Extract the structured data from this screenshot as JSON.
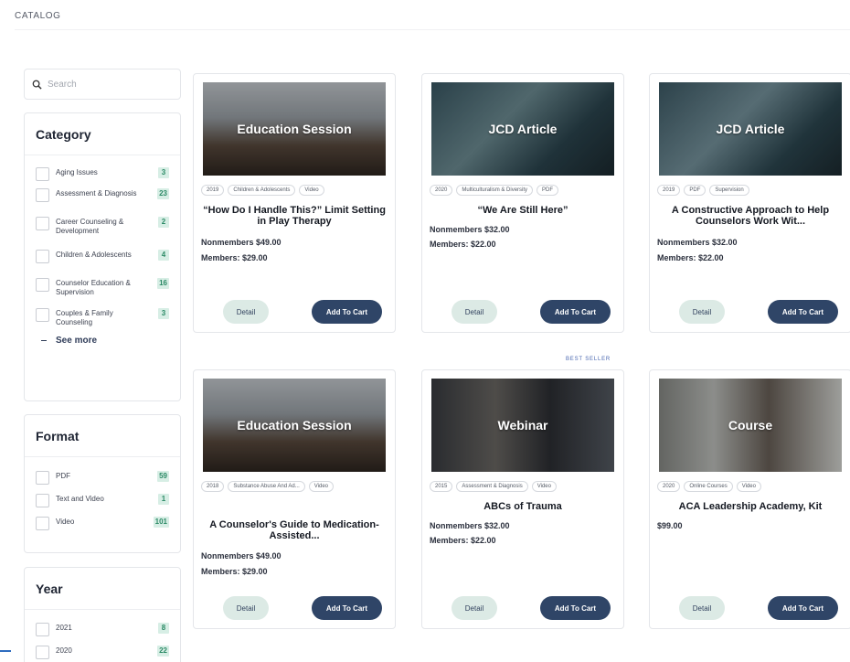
{
  "page": {
    "title": "CATALOG"
  },
  "search": {
    "placeholder": "Search"
  },
  "filters": {
    "category": {
      "title": "Category",
      "items": [
        {
          "label": "Aging Issues",
          "count": "3"
        },
        {
          "label": "Assessment & Diagnosis",
          "count": "23"
        },
        {
          "label": "Career Counseling & Development",
          "count": "2"
        },
        {
          "label": "Children & Adolescents",
          "count": "4"
        },
        {
          "label": "Counselor Education & Supervision",
          "count": "16"
        },
        {
          "label": "Couples & Family Counseling",
          "count": "3"
        }
      ],
      "see_more": "See more"
    },
    "format": {
      "title": "Format",
      "items": [
        {
          "label": "PDF",
          "count": "59"
        },
        {
          "label": "Text and Video",
          "count": "1"
        },
        {
          "label": "Video",
          "count": "101"
        }
      ]
    },
    "year": {
      "title": "Year",
      "items": [
        {
          "label": "2021",
          "count": "8"
        },
        {
          "label": "2020",
          "count": "22"
        }
      ]
    }
  },
  "best_seller_label": "BEST SELLER",
  "buttons": {
    "detail": "Detail",
    "add_to_cart": "Add To Cart"
  },
  "products": [
    {
      "type": "Education Session",
      "tags": [
        "2019",
        "Children & Adolescents",
        "Video"
      ],
      "title": "“How Do I Handle This?” Limit Setting in Play Therapy",
      "nonmembers": "Nonmembers $49.00",
      "members": "Members: $29.00"
    },
    {
      "type": "JCD Article",
      "tags": [
        "2020",
        "Multiculturalism & Diversity",
        "PDF"
      ],
      "title": "“We Are Still Here”",
      "nonmembers": "Nonmembers $32.00",
      "members": "Members: $22.00"
    },
    {
      "type": "JCD Article",
      "tags": [
        "2019",
        "PDF",
        "Supervision"
      ],
      "title": "A Constructive Approach to Help Counselors Work Wit...",
      "nonmembers": "Nonmembers $32.00",
      "members": "Members: $22.00"
    },
    {
      "type": "Education Session",
      "tags": [
        "2018",
        "Substance Abuse And Ad...",
        "Video"
      ],
      "title": "A Counselor's Guide to Medication- Assisted...",
      "nonmembers": "Nonmembers $49.00",
      "members": "Members: $29.00"
    },
    {
      "type": "Webinar",
      "tags": [
        "2015",
        "Assessment & Diagnosis",
        "Video"
      ],
      "title": "ABCs of Trauma",
      "nonmembers": "Nonmembers $32.00",
      "members": "Members: $22.00"
    },
    {
      "type": "Course",
      "tags": [
        "2020",
        "Online Courses",
        "Video"
      ],
      "title": "ACA Leadership Academy, Kit",
      "nonmembers": "$99.00",
      "members": ""
    }
  ]
}
